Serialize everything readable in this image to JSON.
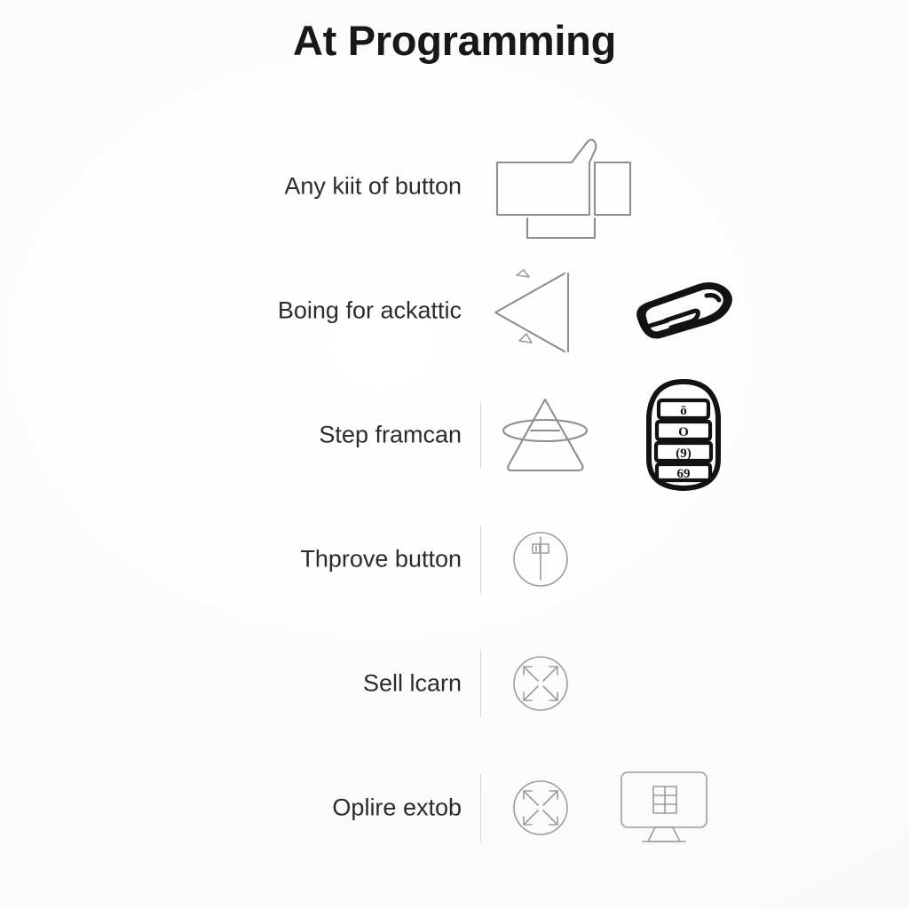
{
  "page": {
    "title": "At Programming",
    "background_color": "#fbfbfb",
    "text_color": "#2a2b2e",
    "icon_stroke_color": "#8d8e90",
    "accent_dark_color": "#111214"
  },
  "rows": [
    {
      "label": "Any kiit of button",
      "has_divider": false,
      "icons": [
        "thumb-block-outline-icon"
      ]
    },
    {
      "label": "Boing for ackattic",
      "has_divider": false,
      "icons": [
        "left-triangle-outline-icon",
        "slim-key-fob-sketch-icon"
      ]
    },
    {
      "label": "Step framcan",
      "has_divider": true,
      "icons": [
        "cone-ellipse-outline-icon",
        "key-fob-four-button-icon"
      ]
    },
    {
      "label": "Thprove button",
      "has_divider": true,
      "icons": [
        "circle-signpost-icon"
      ]
    },
    {
      "label": "Sell lcarn",
      "has_divider": true,
      "icons": [
        "circle-four-arrows-icon"
      ]
    },
    {
      "label": "Oplire extob",
      "has_divider": true,
      "icons": [
        "circle-four-arrows-icon",
        "monitor-document-icon"
      ]
    }
  ],
  "key_fob": {
    "button_glyphs": [
      "ō",
      "O",
      "(9)",
      "69"
    ]
  }
}
